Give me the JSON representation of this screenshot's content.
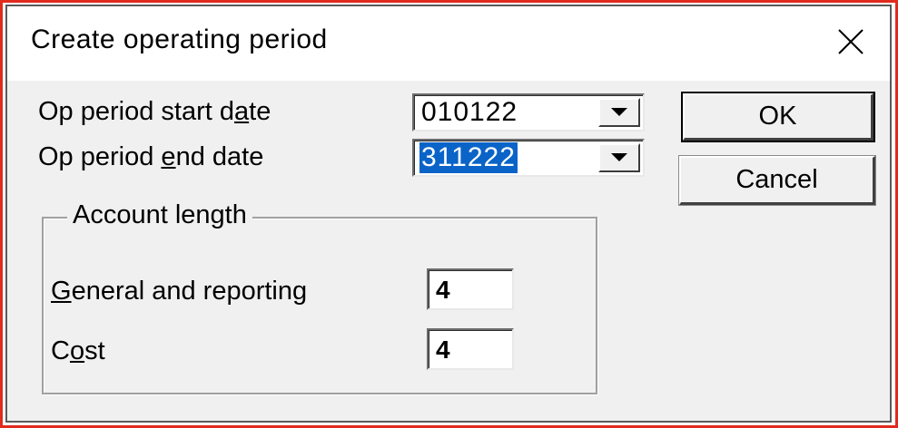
{
  "dialog": {
    "title": "Create operating period",
    "close_icon": "close-icon"
  },
  "start_date": {
    "label_before": "Op period start d",
    "label_accel": "a",
    "label_after": "te",
    "value": "010122"
  },
  "end_date": {
    "label_before": "Op period ",
    "label_accel": "e",
    "label_after": "nd date",
    "value": "311222"
  },
  "buttons": {
    "ok": "OK",
    "cancel": "Cancel"
  },
  "account_length": {
    "group_label": "Account length",
    "general": {
      "label_accel": "G",
      "label_after": "eneral and reporting",
      "value": "4"
    },
    "cost": {
      "label_before": "C",
      "label_accel": "o",
      "label_after": "st",
      "value": "4"
    }
  }
}
